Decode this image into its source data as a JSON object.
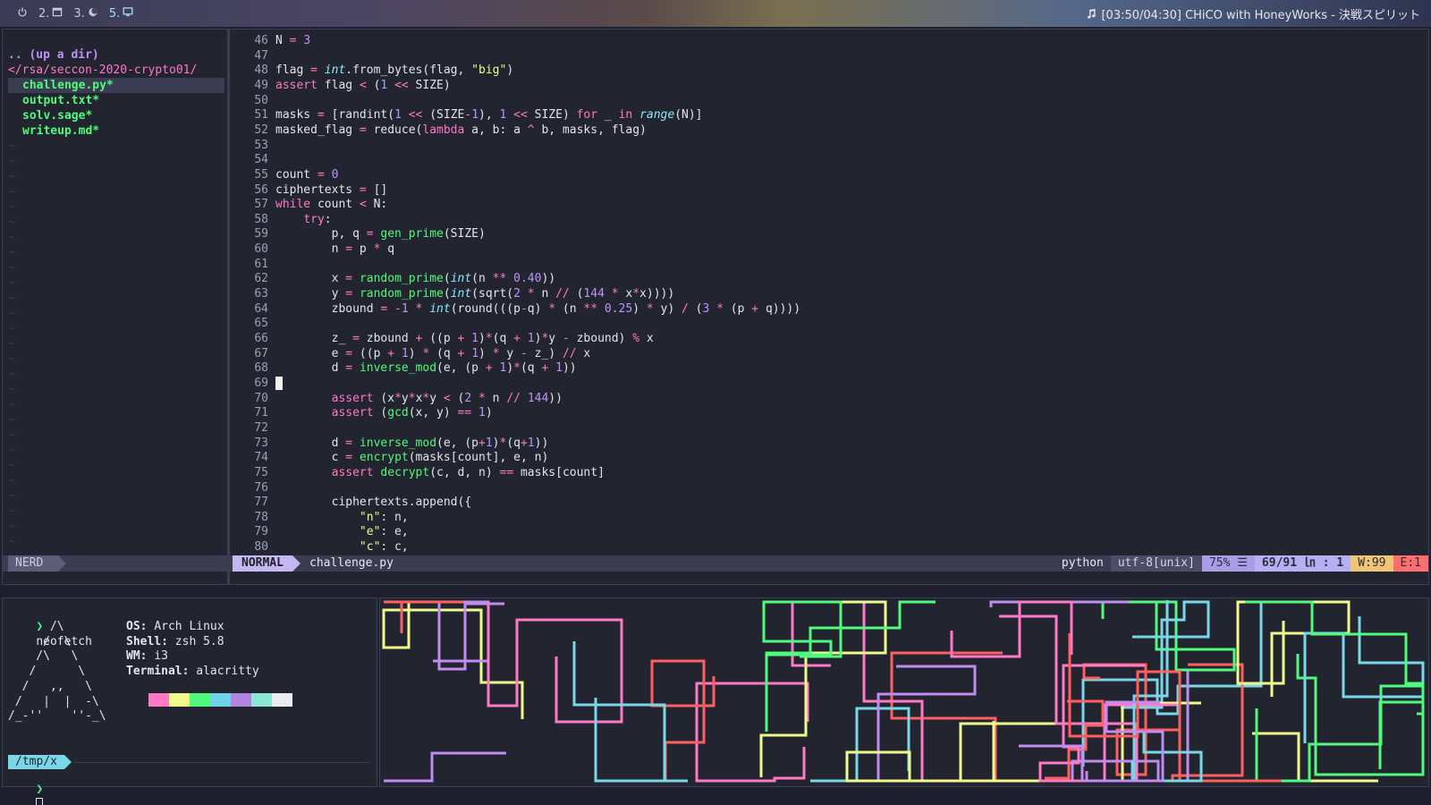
{
  "topbar": {
    "workspaces": [
      {
        "label": "",
        "icon": "power-icon"
      },
      {
        "label": "2.",
        "icon": "window-icon"
      },
      {
        "label": "3.",
        "icon": "moon-icon"
      },
      {
        "label": "5.",
        "icon": "monitor-icon"
      }
    ],
    "now_playing": "[03:50/04:30] CHiCO with HoneyWorks - 決戦スピリット"
  },
  "nerdtree": {
    "up_dir": ".. (up a dir)",
    "path": "</rsa/seccon-2020-crypto01/",
    "files": [
      "challenge.py*",
      "output.txt*",
      "solv.sage*",
      "writeup.md*"
    ],
    "tag": "NERD"
  },
  "code": {
    "cursor_line": 69,
    "lines": [
      {
        "n": "46",
        "t": "N = 3"
      },
      {
        "n": "47",
        "t": ""
      },
      {
        "n": "48",
        "t": "flag = int.from_bytes(flag, \"big\")"
      },
      {
        "n": "49",
        "t": "assert flag < (1 << SIZE)"
      },
      {
        "n": "50",
        "t": ""
      },
      {
        "n": "51",
        "t": "masks = [randint(1 << (SIZE-1), 1 << SIZE) for _ in range(N)]"
      },
      {
        "n": "52",
        "t": "masked_flag = reduce(lambda a, b: a ^ b, masks, flag)"
      },
      {
        "n": "53",
        "t": ""
      },
      {
        "n": "54",
        "t": ""
      },
      {
        "n": "55",
        "t": "count = 0"
      },
      {
        "n": "56",
        "t": "ciphertexts = []"
      },
      {
        "n": "57",
        "t": "while count < N:"
      },
      {
        "n": "58",
        "t": "    try:"
      },
      {
        "n": "59",
        "t": "        p, q = gen_prime(SIZE)"
      },
      {
        "n": "60",
        "t": "        n = p * q"
      },
      {
        "n": "61",
        "t": ""
      },
      {
        "n": "62",
        "t": "        x = random_prime(int(n ** 0.40))"
      },
      {
        "n": "63",
        "t": "        y = random_prime(int(sqrt(2 * n // (144 * x*x))))"
      },
      {
        "n": "64",
        "t": "        zbound = -1 * int(round(((p-q) * (n ** 0.25) * y) / (3 * (p + q))))"
      },
      {
        "n": "65",
        "t": ""
      },
      {
        "n": "66",
        "t": "        z_ = zbound + ((p + 1)*(q + 1)*y - zbound) % x"
      },
      {
        "n": "67",
        "t": "        e = ((p + 1) * (q + 1) * y - z_) // x"
      },
      {
        "n": "68",
        "t": "        d = inverse_mod(e, (p + 1)*(q + 1))"
      },
      {
        "n": "69",
        "t": ""
      },
      {
        "n": "70",
        "t": "        assert (x*y*x*y < (2 * n // 144))"
      },
      {
        "n": "71",
        "t": "        assert (gcd(x, y) == 1)"
      },
      {
        "n": "72",
        "t": ""
      },
      {
        "n": "73",
        "t": "        d = inverse_mod(e, (p+1)*(q+1))"
      },
      {
        "n": "74",
        "t": "        c = encrypt(masks[count], e, n)"
      },
      {
        "n": "75",
        "t": "        assert decrypt(c, d, n) == masks[count]"
      },
      {
        "n": "76",
        "t": ""
      },
      {
        "n": "77",
        "t": "        ciphertexts.append({"
      },
      {
        "n": "78",
        "t": "            \"n\": n,"
      },
      {
        "n": "79",
        "t": "            \"e\": e,"
      },
      {
        "n": "80",
        "t": "            \"c\": c,"
      }
    ]
  },
  "statusline": {
    "mode": "NORMAL",
    "filename": "challenge.py",
    "filetype": "python",
    "encoding": "utf-8[unix]",
    "percent": "75% ☰",
    "position": "69/91 ㏑ :  1",
    "warnings": "W:99",
    "errors": "E:1"
  },
  "terminal": {
    "prompt_symbol": "❯",
    "command": "neofetch",
    "ascii_art": [
      "      /\\",
      "     /  \\",
      "    /\\   \\",
      "   /      \\",
      "  /   ,,   \\",
      " /   |  |  -\\",
      "/_-''    ''-_\\"
    ],
    "info": [
      {
        "key": "OS:",
        "value": "Arch Linux"
      },
      {
        "key": "Shell:",
        "value": "zsh 5.8"
      },
      {
        "key": "WM:",
        "value": "i3"
      },
      {
        "key": "Terminal:",
        "value": "alacritty"
      }
    ],
    "swatches": [
      "#ff79c6",
      "#f1fa8c",
      "#50fa7b",
      "#6fd3ea",
      "#b084e0",
      "#8ee6d6",
      "#ecebf2"
    ],
    "cwd": "/tmp/x"
  },
  "pipes_colors": [
    "#ff5f5f",
    "#7ad7e8",
    "#f1fa8c",
    "#50fa7b",
    "#c08cf0",
    "#ff79c6"
  ]
}
